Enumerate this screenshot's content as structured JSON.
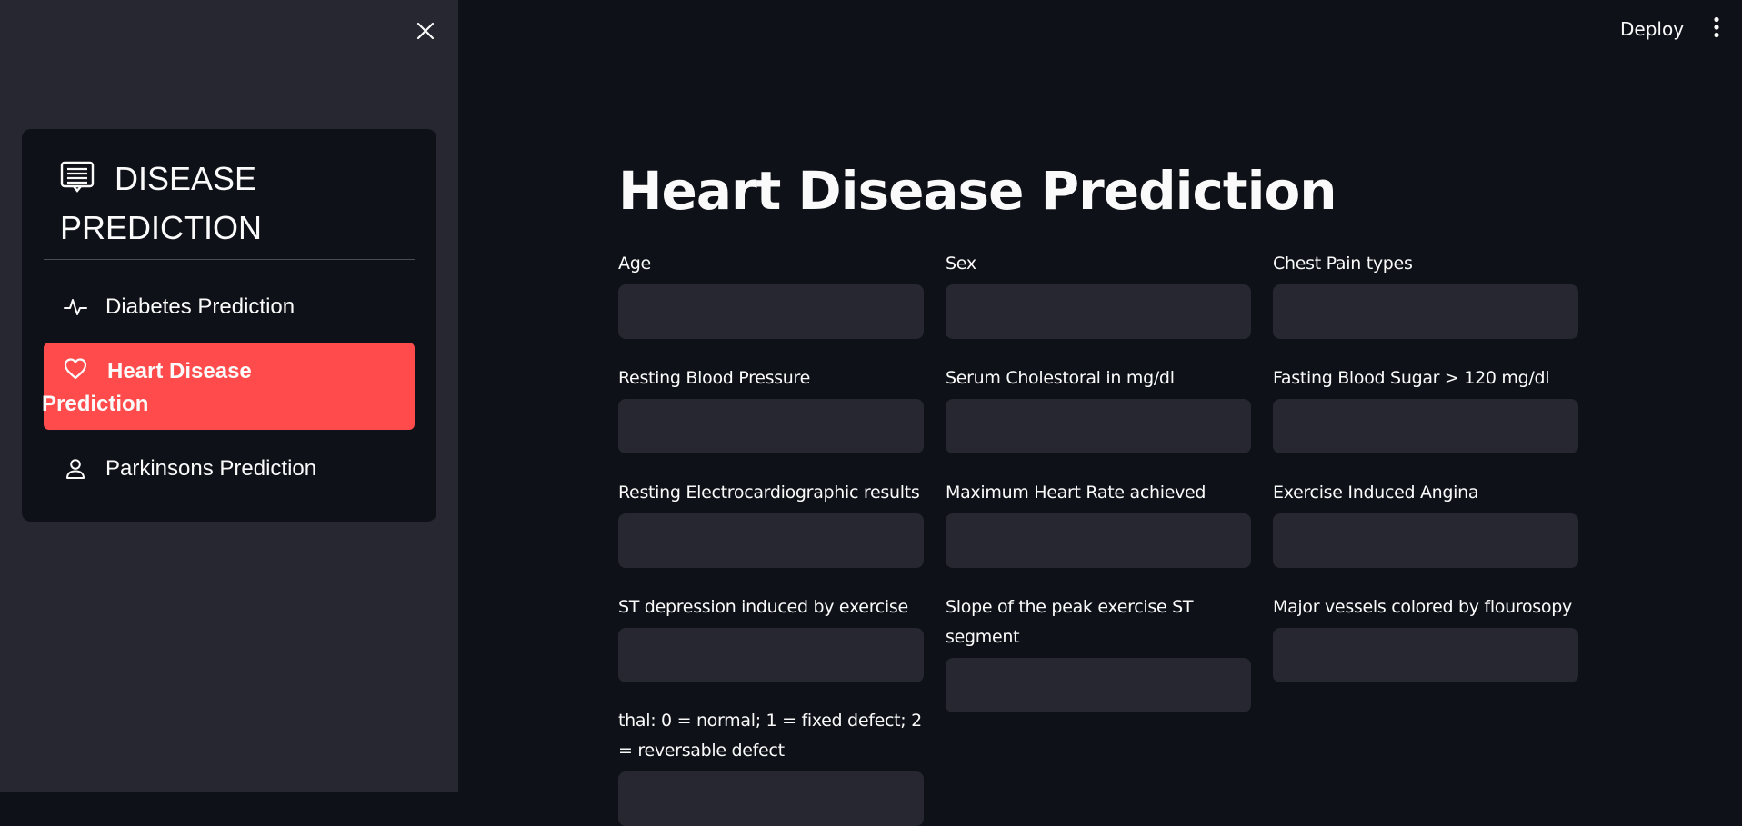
{
  "sidebar": {
    "title": "DISEASE PREDICTION",
    "title_icon": "document-icon",
    "close_icon": "close-icon",
    "items": [
      {
        "label": "Diabetes Prediction",
        "icon": "activity-icon",
        "active": false
      },
      {
        "label": "Heart Disease Prediction",
        "icon": "heart-icon",
        "active": true
      },
      {
        "label": "Parkinsons Prediction",
        "icon": "person-icon",
        "active": false
      }
    ],
    "active_color": "#ff4b4b"
  },
  "topbar": {
    "deploy_label": "Deploy",
    "menu_icon": "more-vertical-icon"
  },
  "main": {
    "title": "Heart Disease Prediction",
    "fields": [
      {
        "label": "Age",
        "value": ""
      },
      {
        "label": "Sex",
        "value": ""
      },
      {
        "label": "Chest Pain types",
        "value": ""
      },
      {
        "label": "Resting Blood Pressure",
        "value": ""
      },
      {
        "label": "Serum Cholestoral in mg/dl",
        "value": ""
      },
      {
        "label": "Fasting Blood Sugar > 120 mg/dl",
        "value": ""
      },
      {
        "label": "Resting Electrocardiographic results",
        "value": ""
      },
      {
        "label": "Maximum Heart Rate achieved",
        "value": ""
      },
      {
        "label": "Exercise Induced Angina",
        "value": ""
      },
      {
        "label": "ST depression induced by exercise",
        "value": ""
      },
      {
        "label": "Slope of the peak exercise ST segment",
        "value": ""
      },
      {
        "label": "Major vessels colored by flourosopy",
        "value": ""
      },
      {
        "label": "thal: 0 = normal; 1 = fixed defect; 2 = reversable defect",
        "value": ""
      }
    ]
  },
  "colors": {
    "background": "#0e1117",
    "sidebar": "#262730",
    "input": "#262730",
    "accent": "#ff4b4b"
  }
}
